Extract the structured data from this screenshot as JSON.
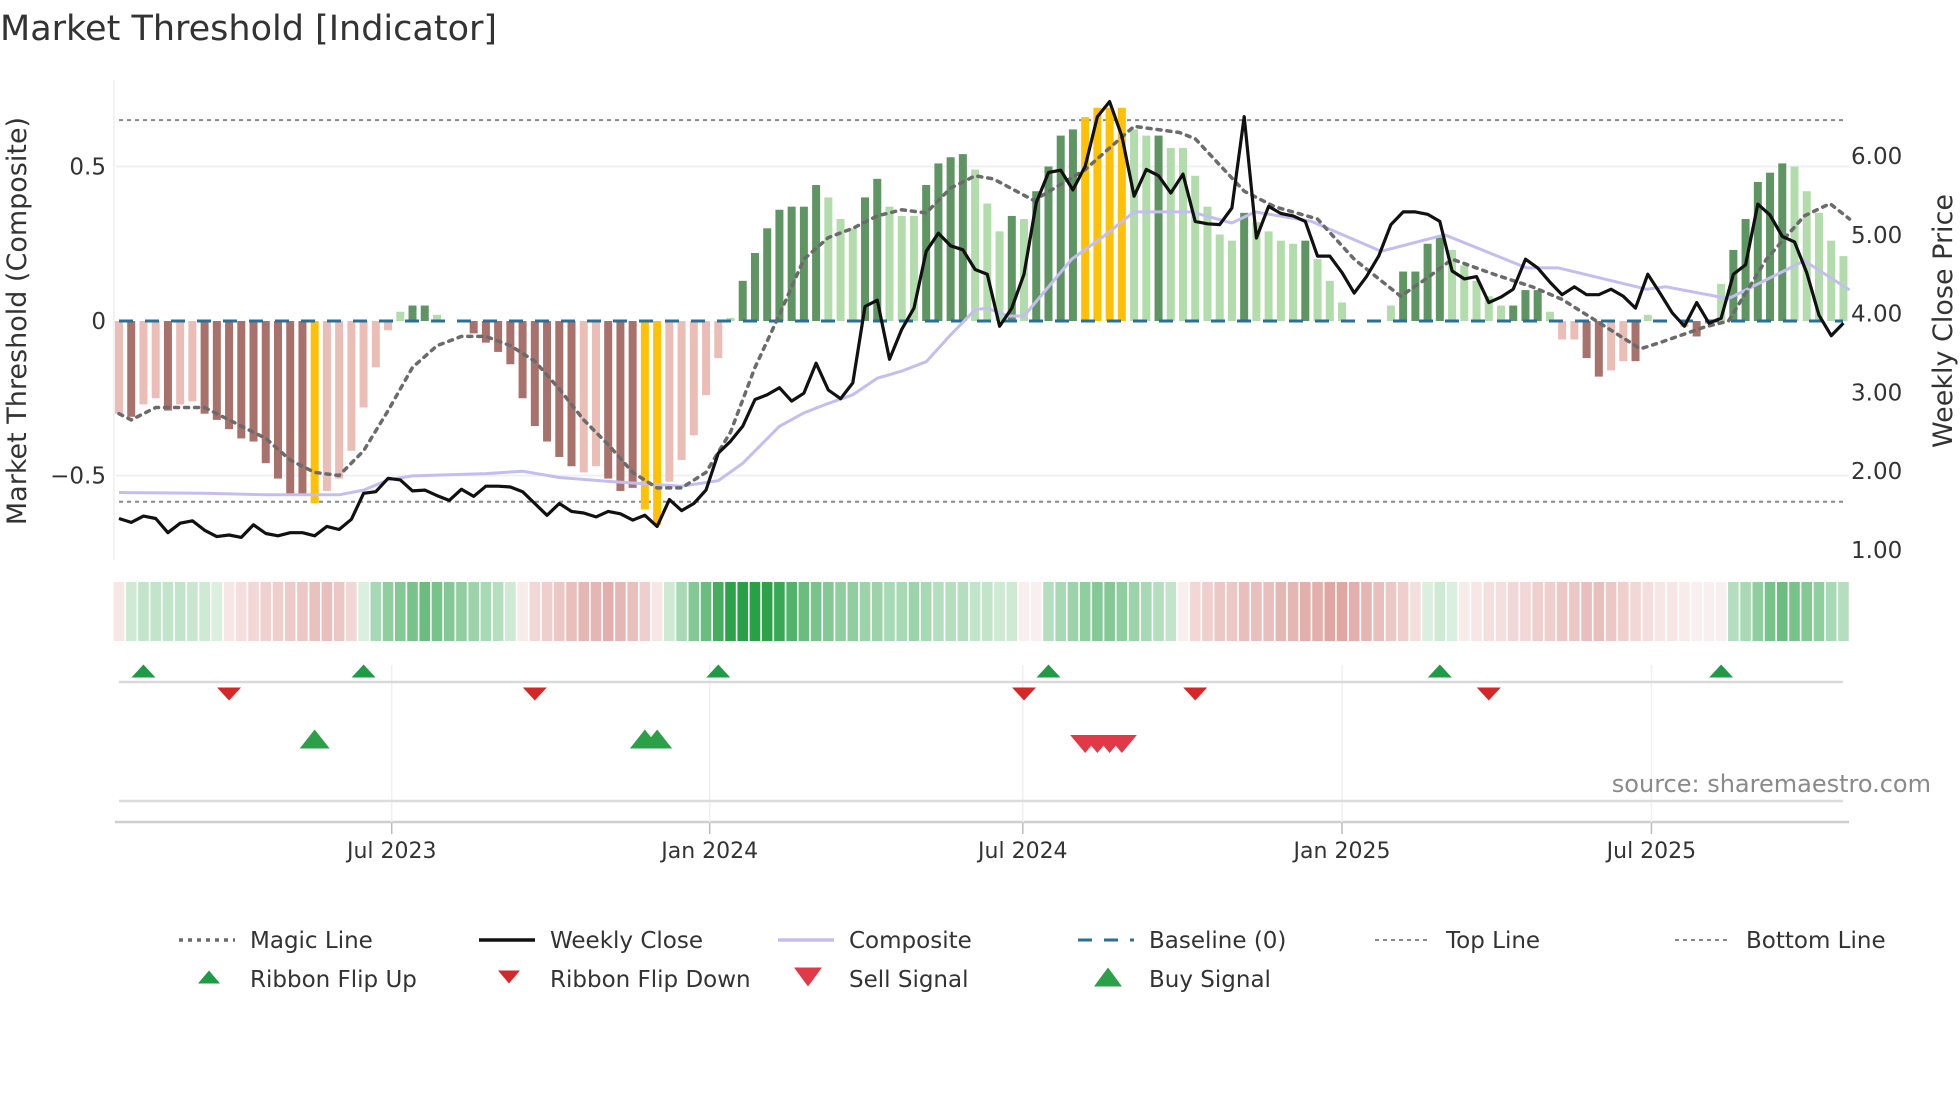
{
  "chart_data": {
    "type": "bar",
    "title": "Market Threshold [Indicator]",
    "ylabel": "Market Threshold (Composite)",
    "y2label": "Weekly Close Price",
    "ylim": [
      -0.78,
      0.78
    ],
    "y2lim": [
      0.9,
      6.9
    ],
    "grid": true,
    "left_ticks": [
      {
        "v": 0.5,
        "label": "0.5"
      },
      {
        "v": 0,
        "label": "0"
      },
      {
        "v": -0.5,
        "label": "−0.5"
      }
    ],
    "right_ticks": [
      {
        "v": 6,
        "label": "6.00"
      },
      {
        "v": 5,
        "label": "5.00"
      },
      {
        "v": 4,
        "label": "4.00"
      },
      {
        "v": 3,
        "label": "3.00"
      },
      {
        "v": 2,
        "label": "2.00"
      },
      {
        "v": 1,
        "label": "1.00"
      }
    ],
    "x_unit": "week index",
    "x_ticks": [
      {
        "week": 22.3,
        "label": "Jul 2023"
      },
      {
        "week": 48.3,
        "label": "Jan 2024"
      },
      {
        "week": 73.9,
        "label": "Jul 2024"
      },
      {
        "week": 100.0,
        "label": "Jan 2025"
      },
      {
        "week": 125.3,
        "label": "Jul 2025"
      }
    ],
    "top_line": 0.65,
    "bottom_line": -0.585,
    "baseline": 0,
    "composite_bars": [
      -0.3,
      -0.31,
      -0.27,
      -0.25,
      -0.29,
      -0.27,
      -0.26,
      -0.3,
      -0.32,
      -0.35,
      -0.38,
      -0.39,
      -0.46,
      -0.51,
      -0.56,
      -0.56,
      -0.59,
      -0.55,
      -0.51,
      -0.42,
      -0.28,
      -0.15,
      -0.03,
      0.03,
      0.05,
      0.05,
      0.02,
      0,
      0,
      -0.04,
      -0.07,
      -0.1,
      -0.14,
      -0.25,
      -0.34,
      -0.39,
      -0.44,
      -0.47,
      -0.49,
      -0.47,
      -0.51,
      -0.55,
      -0.54,
      -0.61,
      -0.66,
      -0.52,
      -0.45,
      -0.37,
      -0.24,
      -0.12,
      0.01,
      0.13,
      0.22,
      0.3,
      0.36,
      0.37,
      0.37,
      0.44,
      0.4,
      0.33,
      0.3,
      0.4,
      0.46,
      0.37,
      0.34,
      0.34,
      0.44,
      0.51,
      0.53,
      0.54,
      0.49,
      0.38,
      0.29,
      0.34,
      0.33,
      0.42,
      0.5,
      0.6,
      0.62,
      0.66,
      0.69,
      0.69,
      0.69,
      0.62,
      0.6,
      0.6,
      0.56,
      0.56,
      0.47,
      0.37,
      0.28,
      0.26,
      0.35,
      0.32,
      0.29,
      0.26,
      0.25,
      0.26,
      0.2,
      0.13,
      0.06,
      0,
      0,
      0,
      0.05,
      0.16,
      0.16,
      0.25,
      0.27,
      0.23,
      0.18,
      0.13,
      0.08,
      0.05,
      0.05,
      0.1,
      0.1,
      0.03,
      -0.06,
      -0.06,
      -0.12,
      -0.18,
      -0.16,
      -0.13,
      -0.13,
      0.02,
      0,
      0,
      -0.02,
      -0.05,
      -0.01,
      0.12,
      0.23,
      0.33,
      0.45,
      0.48,
      0.51,
      0.5,
      0.42,
      0.35,
      0.26,
      0.21
    ],
    "bar_kind": [
      "lr",
      "dr",
      "lr",
      "lr",
      "dr",
      "lr",
      "lr",
      "dr",
      "dr",
      "dr",
      "dr",
      "dr",
      "dr",
      "dr",
      "dr",
      "dr",
      "y",
      "lr",
      "lr",
      "lr",
      "lr",
      "lr",
      "lr",
      "lg",
      "dg",
      "dg",
      "lg",
      "n",
      "n",
      "dr",
      "dr",
      "dr",
      "dr",
      "dr",
      "dr",
      "dr",
      "dr",
      "dr",
      "lr",
      "lr",
      "dr",
      "dr",
      "dr",
      "y",
      "y",
      "lr",
      "lr",
      "lr",
      "lr",
      "lr",
      "lg",
      "dg",
      "dg",
      "dg",
      "dg",
      "dg",
      "dg",
      "dg",
      "lg",
      "lg",
      "lg",
      "dg",
      "dg",
      "lg",
      "lg",
      "lg",
      "dg",
      "dg",
      "dg",
      "dg",
      "lg",
      "lg",
      "lg",
      "dg",
      "lg",
      "dg",
      "dg",
      "dg",
      "dg",
      "y",
      "y",
      "y",
      "y",
      "lg",
      "lg",
      "dg",
      "lg",
      "lg",
      "lg",
      "lg",
      "lg",
      "lg",
      "dg",
      "lg",
      "lg",
      "lg",
      "lg",
      "dg",
      "lg",
      "lg",
      "lg",
      "n",
      "n",
      "n",
      "lg",
      "dg",
      "dg",
      "dg",
      "dg",
      "lg",
      "lg",
      "lg",
      "lg",
      "lg",
      "dg",
      "dg",
      "dg",
      "lg",
      "lr",
      "lr",
      "dr",
      "dr",
      "lr",
      "lr",
      "dr",
      "lg",
      "n",
      "n",
      "lr",
      "dr",
      "lr",
      "lg",
      "dg",
      "dg",
      "dg",
      "dg",
      "dg",
      "lg",
      "lg",
      "lg",
      "lg",
      "lg"
    ],
    "weekly_close": [
      1.4,
      1.35,
      1.43,
      1.4,
      1.22,
      1.34,
      1.37,
      1.25,
      1.17,
      1.19,
      1.16,
      1.32,
      1.21,
      1.18,
      1.22,
      1.22,
      1.18,
      1.3,
      1.26,
      1.39,
      1.72,
      1.74,
      1.91,
      1.89,
      1.75,
      1.76,
      1.69,
      1.63,
      1.77,
      1.68,
      1.81,
      1.81,
      1.8,
      1.74,
      1.59,
      1.44,
      1.59,
      1.49,
      1.47,
      1.42,
      1.49,
      1.46,
      1.38,
      1.44,
      1.3,
      1.64,
      1.5,
      1.59,
      1.76,
      2.23,
      2.38,
      2.57,
      2.91,
      2.97,
      3.06,
      2.89,
      2.99,
      3.37,
      3.03,
      2.92,
      3.12,
      4.09,
      4.17,
      3.42,
      3.8,
      4.07,
      4.79,
      5.02,
      4.86,
      4.81,
      4.56,
      4.5,
      3.84,
      4.07,
      4.5,
      5.41,
      5.79,
      5.82,
      5.57,
      5.87,
      6.5,
      6.69,
      6.25,
      5.49,
      5.83,
      5.75,
      5.53,
      5.77,
      5.17,
      5.14,
      5.13,
      5.34,
      6.5,
      4.96,
      5.36,
      5.27,
      5.24,
      5.17,
      4.73,
      4.73,
      4.52,
      4.26,
      4.47,
      4.73,
      5.13,
      5.29,
      5.29,
      5.26,
      5.17,
      4.54,
      4.44,
      4.47,
      4.14,
      4.21,
      4.31,
      4.69,
      4.58,
      4.4,
      4.24,
      4.34,
      4.24,
      4.24,
      4.31,
      4.22,
      4.07,
      4.5,
      4.26,
      4.01,
      3.84,
      4.14,
      3.88,
      3.94,
      4.5,
      4.62,
      5.39,
      5.25,
      4.98,
      4.91,
      4.52,
      3.98,
      3.72,
      3.88
    ],
    "magic_line": [
      [
        0,
        -0.3
      ],
      [
        1,
        -0.32
      ],
      [
        3,
        -0.28
      ],
      [
        7,
        -0.28
      ],
      [
        9,
        -0.32
      ],
      [
        12,
        -0.38
      ],
      [
        14,
        -0.45
      ],
      [
        16,
        -0.49
      ],
      [
        18,
        -0.5
      ],
      [
        20,
        -0.42
      ],
      [
        22,
        -0.29
      ],
      [
        24,
        -0.15
      ],
      [
        26,
        -0.08
      ],
      [
        28,
        -0.05
      ],
      [
        30,
        -0.05
      ],
      [
        32,
        -0.08
      ],
      [
        34,
        -0.13
      ],
      [
        36,
        -0.22
      ],
      [
        38,
        -0.32
      ],
      [
        40,
        -0.4
      ],
      [
        42,
        -0.49
      ],
      [
        44,
        -0.54
      ],
      [
        46,
        -0.54
      ],
      [
        48,
        -0.49
      ],
      [
        50,
        -0.36
      ],
      [
        52,
        -0.15
      ],
      [
        54,
        0.02
      ],
      [
        56,
        0.2
      ],
      [
        58,
        0.27
      ],
      [
        60,
        0.3
      ],
      [
        62,
        0.34
      ],
      [
        64,
        0.36
      ],
      [
        66,
        0.35
      ],
      [
        68,
        0.43
      ],
      [
        70,
        0.47
      ],
      [
        71.5,
        0.46
      ],
      [
        74.8,
        0.39
      ],
      [
        79,
        0.49
      ],
      [
        83,
        0.63
      ],
      [
        86.7,
        0.61
      ],
      [
        88,
        0.59
      ],
      [
        92,
        0.42
      ],
      [
        94.5,
        0.37
      ],
      [
        98,
        0.33
      ],
      [
        101,
        0.2
      ],
      [
        104.8,
        0.08
      ],
      [
        107,
        0.14
      ],
      [
        109,
        0.2
      ],
      [
        112.5,
        0.15
      ],
      [
        115.6,
        0.11
      ],
      [
        118,
        0.07
      ],
      [
        120.8,
        0
      ],
      [
        124.4,
        -0.09
      ],
      [
        126,
        -0.07
      ],
      [
        129.6,
        -0.02
      ],
      [
        131.6,
        0
      ],
      [
        134.7,
        0.2
      ],
      [
        137.8,
        0.34
      ],
      [
        139.9,
        0.38
      ],
      [
        141.5,
        0.33
      ]
    ],
    "composite_line": [
      [
        0,
        1.73
      ],
      [
        7,
        1.72
      ],
      [
        12,
        1.7
      ],
      [
        18,
        1.7
      ],
      [
        20,
        1.76
      ],
      [
        22,
        1.89
      ],
      [
        24,
        1.94
      ],
      [
        30,
        1.97
      ],
      [
        33,
        2.0
      ],
      [
        36,
        1.92
      ],
      [
        40,
        1.87
      ],
      [
        44,
        1.83
      ],
      [
        46,
        1.81
      ],
      [
        49,
        1.88
      ],
      [
        51,
        2.1
      ],
      [
        54,
        2.57
      ],
      [
        56,
        2.74
      ],
      [
        58,
        2.86
      ],
      [
        60,
        2.97
      ],
      [
        62,
        3.18
      ],
      [
        64,
        3.27
      ],
      [
        66,
        3.39
      ],
      [
        68,
        3.73
      ],
      [
        70,
        4.05
      ],
      [
        71,
        4.07
      ],
      [
        72.7,
        3.97
      ],
      [
        74,
        3.97
      ],
      [
        77.9,
        4.69
      ],
      [
        80.5,
        4.98
      ],
      [
        83,
        5.29
      ],
      [
        87.7,
        5.29
      ],
      [
        91,
        5.15
      ],
      [
        92.9,
        5.29
      ],
      [
        97.5,
        5.17
      ],
      [
        103.2,
        4.79
      ],
      [
        108.4,
        5.0
      ],
      [
        115.1,
        4.58
      ],
      [
        117.7,
        4.58
      ],
      [
        124.9,
        4.31
      ],
      [
        126.5,
        4.34
      ],
      [
        131.6,
        4.19
      ],
      [
        137.8,
        4.67
      ],
      [
        141.5,
        4.3
      ]
    ],
    "ribbon_strength": [
      -0.15,
      0.2,
      0.25,
      0.25,
      0.25,
      0.25,
      0.22,
      0.2,
      0.15,
      -0.15,
      -0.2,
      -0.25,
      -0.28,
      -0.3,
      -0.32,
      -0.35,
      -0.38,
      -0.4,
      -0.35,
      -0.25,
      0.15,
      0.35,
      0.45,
      0.5,
      0.55,
      0.6,
      0.55,
      0.5,
      0.45,
      0.4,
      0.35,
      0.3,
      0.2,
      -0.12,
      -0.25,
      -0.3,
      -0.35,
      -0.4,
      -0.45,
      -0.45,
      -0.5,
      -0.45,
      -0.4,
      -0.3,
      -0.15,
      0.2,
      0.35,
      0.5,
      0.6,
      0.75,
      0.85,
      0.9,
      0.9,
      0.85,
      0.8,
      0.7,
      0.6,
      0.55,
      0.5,
      0.45,
      0.45,
      0.4,
      0.4,
      0.35,
      0.35,
      0.4,
      0.35,
      0.3,
      0.3,
      0.3,
      0.25,
      0.25,
      0.2,
      0.2,
      -0.1,
      -0.1,
      0.3,
      0.35,
      0.4,
      0.45,
      0.5,
      0.5,
      0.45,
      0.4,
      0.35,
      0.3,
      0.25,
      -0.1,
      -0.25,
      -0.3,
      -0.35,
      -0.35,
      -0.4,
      -0.4,
      -0.4,
      -0.45,
      -0.45,
      -0.5,
      -0.5,
      -0.55,
      -0.55,
      -0.5,
      -0.45,
      -0.4,
      -0.35,
      -0.3,
      -0.2,
      0.15,
      0.2,
      0.15,
      -0.12,
      -0.15,
      -0.2,
      -0.2,
      -0.25,
      -0.25,
      -0.3,
      -0.3,
      -0.35,
      -0.35,
      -0.4,
      -0.4,
      -0.35,
      -0.3,
      -0.25,
      -0.2,
      -0.15,
      -0.15,
      -0.12,
      -0.1,
      -0.1,
      -0.1,
      0.3,
      0.35,
      0.45,
      0.55,
      0.6,
      0.55,
      0.5,
      0.45,
      0.35,
      0.3
    ],
    "ribbon_flip_up": [
      2,
      20,
      49,
      76,
      108,
      131
    ],
    "ribbon_flip_down": [
      9,
      34,
      74,
      88,
      112
    ],
    "buy_signal": [
      16,
      43,
      44
    ],
    "sell_signal": [
      79,
      80,
      81,
      82
    ],
    "source": "source: sharemaestro.com",
    "legend": {
      "position": "bottom",
      "items": [
        {
          "key": "magic",
          "label": "Magic Line"
        },
        {
          "key": "close",
          "label": "Weekly Close"
        },
        {
          "key": "composite",
          "label": "Composite"
        },
        {
          "key": "baseline",
          "label": "Baseline (0)"
        },
        {
          "key": "top",
          "label": "Top Line"
        },
        {
          "key": "bottom",
          "label": "Bottom Line"
        },
        {
          "key": "flipup",
          "label": "Ribbon Flip Up"
        },
        {
          "key": "flipdown",
          "label": "Ribbon Flip Down"
        },
        {
          "key": "sell",
          "label": "Sell Signal"
        },
        {
          "key": "buy",
          "label": "Buy Signal"
        }
      ]
    },
    "colors": {
      "dark_red": "#a8716b",
      "light_red": "#ebbdb7",
      "dark_green": "#5f9463",
      "light_green": "#b2dcab",
      "yellow": "#ffc107",
      "close": "#111111",
      "magic": "#6b6b6b",
      "composite": "#c4bdf0",
      "baseline": "#2b6f96",
      "threshold": "#888888",
      "flip_up": "#1f9a45",
      "flip_down": "#d62728",
      "buy": "#2ca048",
      "sell": "#e03a48"
    }
  }
}
